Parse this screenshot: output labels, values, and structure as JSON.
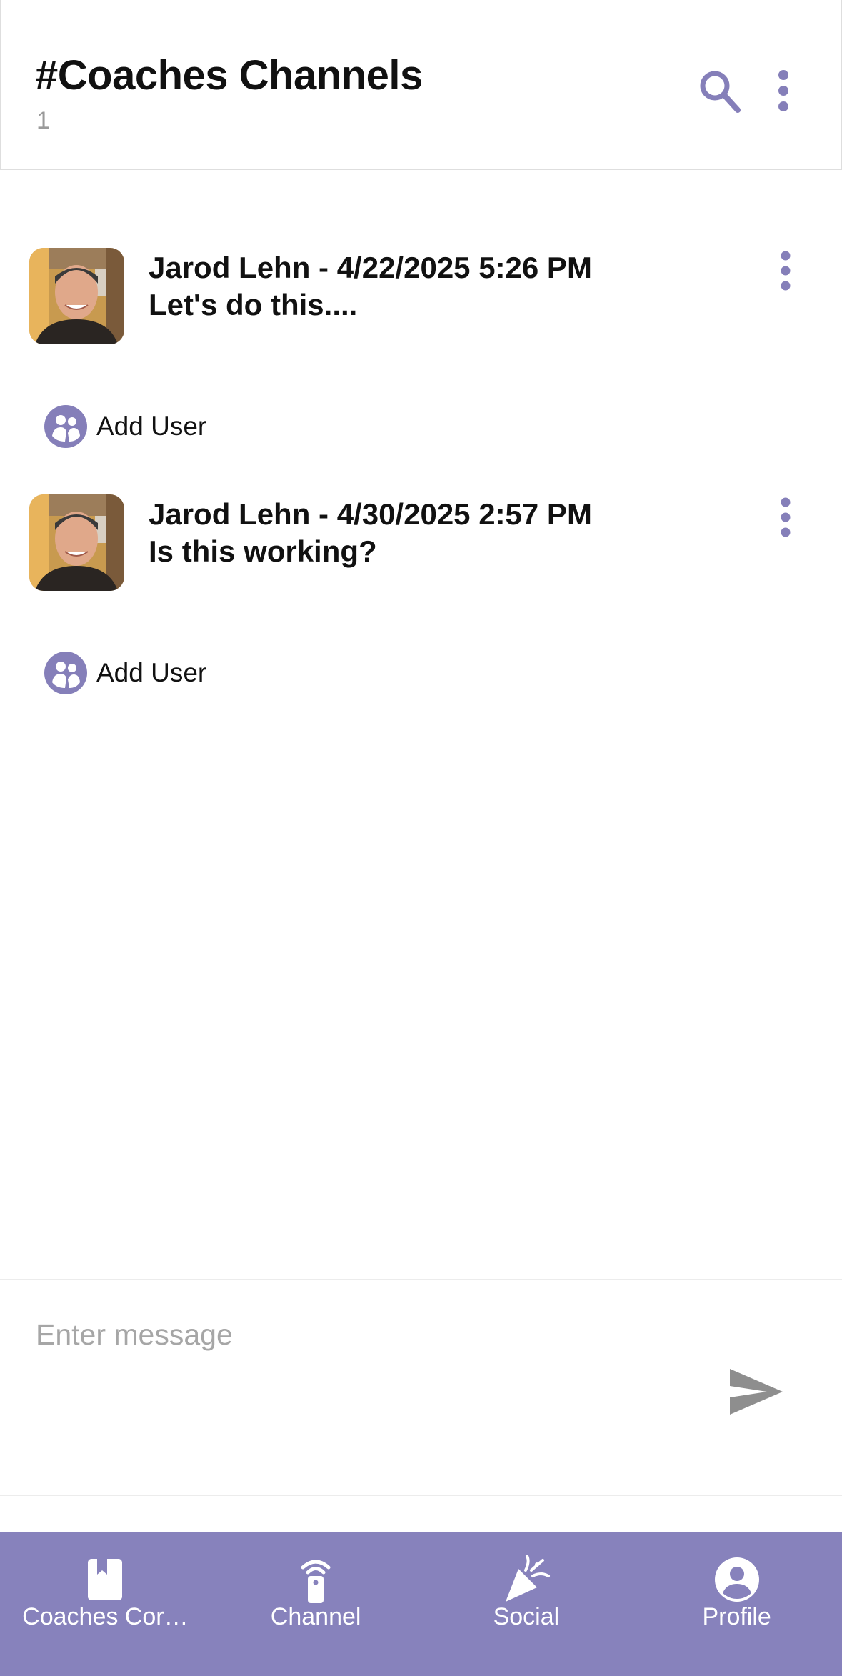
{
  "header": {
    "title": "#Coaches Channels",
    "subtitle": "1",
    "search_icon": "search-icon",
    "more_icon": "more-vertical-icon"
  },
  "messages": [
    {
      "author": "Jarod Lehn",
      "timestamp": "4/22/2025 5:26 PM",
      "header": "Jarod Lehn  - 4/22/2025 5:26 PM",
      "text": "Let's do this....",
      "add_user_label": "Add User"
    },
    {
      "author": "Jarod Lehn",
      "timestamp": "4/30/2025 2:57 PM",
      "header": "Jarod Lehn  - 4/30/2025 2:57 PM",
      "text": "Is this working?",
      "add_user_label": "Add User"
    }
  ],
  "composer": {
    "placeholder": "Enter message",
    "value": "",
    "send_icon": "send-icon"
  },
  "tabbar": {
    "tabs": [
      {
        "label": "Coaches Cor…",
        "icon": "book-icon"
      },
      {
        "label": "Channel",
        "icon": "broadcast-icon"
      },
      {
        "label": "Social",
        "icon": "party-popper-icon"
      },
      {
        "label": "Profile",
        "icon": "account-circle-icon"
      }
    ]
  },
  "colors": {
    "accent": "#8782bc",
    "icon_purple": "#857fb9",
    "send_gray": "#8e8e8e",
    "placeholder_gray": "#a6a6a6"
  }
}
